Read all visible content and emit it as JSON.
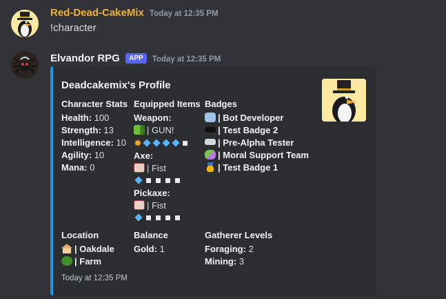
{
  "message1": {
    "username": "Red-Dead-CakeMix",
    "timestamp": "Today at 12:35 PM",
    "text": "!character",
    "username_color": "#f0b232"
  },
  "message2": {
    "username": "Elvandor RPG",
    "badge": "APP",
    "timestamp": "Today at 12:35 PM"
  },
  "embed": {
    "accent_color": "#1e96e6",
    "title": "Deadcakemix's Profile",
    "stats": {
      "heading": "Character Stats",
      "rows": [
        {
          "label": "Health:",
          "value": "100"
        },
        {
          "label": "Strength:",
          "value": "13"
        },
        {
          "label": "Intelligence:",
          "value": "10"
        },
        {
          "label": "Agility:",
          "value": "10"
        },
        {
          "label": "Mana:",
          "value": "0"
        }
      ]
    },
    "equipped": {
      "heading": "Equipped Items",
      "weapon_label": "Weapon:",
      "weapon_name": "| GUN!",
      "axe_label": "Axe:",
      "axe_name": "| Fist",
      "pickaxe_label": "Pickaxe:",
      "pickaxe_name": "| Fist"
    },
    "badges": {
      "heading": "Badges",
      "items": [
        {
          "name": "| Bot Developer",
          "icon": "robot-icon"
        },
        {
          "name": "| Test Badge 2",
          "icon": "glasses-icon"
        },
        {
          "name": "| Pre-Alpha Tester",
          "icon": "goggles-icon"
        },
        {
          "name": "| Moral Support Team",
          "icon": "theater-masks-icon"
        },
        {
          "name": "| Test Badge 1",
          "icon": "medal-icon"
        }
      ]
    },
    "location": {
      "heading": "Location",
      "items": [
        {
          "name": "| Oakdale",
          "icon": "house-icon"
        },
        {
          "name": "| Farm",
          "icon": "bush-icon"
        }
      ]
    },
    "balance": {
      "heading": "Balance",
      "label": "Gold:",
      "value": "1"
    },
    "gatherer": {
      "heading": "Gatherer Levels",
      "rows": [
        {
          "label": "Foraging:",
          "value": "2"
        },
        {
          "label": "Mining:",
          "value": "3"
        }
      ]
    },
    "footer": "Today at 12:35 PM"
  }
}
